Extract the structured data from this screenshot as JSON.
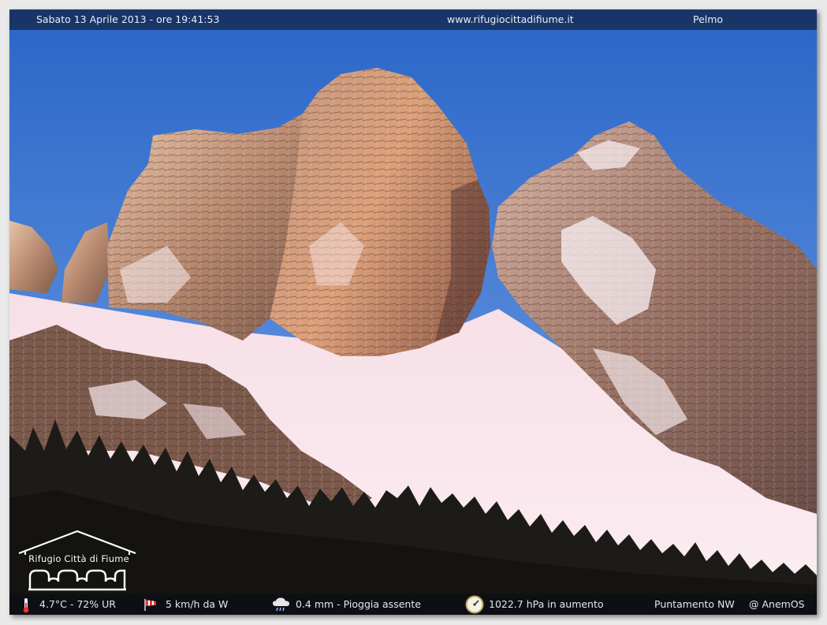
{
  "header": {
    "datetime": "Sabato 13 Aprile 2013 - ore 19:41:53",
    "website": "www.rifugiocittadifiume.it",
    "camera_name": "Pelmo"
  },
  "logo": {
    "text": "Rifugio Città di Fiume"
  },
  "weather": {
    "temperature_humidity": "4.7°C - 72% UR",
    "wind": "5 km/h da W",
    "rain": "0.4 mm - Pioggia assente",
    "pressure": "1022.7 hPa in aumento",
    "pointing": "Puntamento NW",
    "credit": "@ AnemOS"
  },
  "colors": {
    "sky_top": "#2f6fd0",
    "sky_bottom": "#6fa0e4",
    "rock_lit": "#d9a07a",
    "snow": "#f6e4ea",
    "forest": "#1c1a17"
  }
}
